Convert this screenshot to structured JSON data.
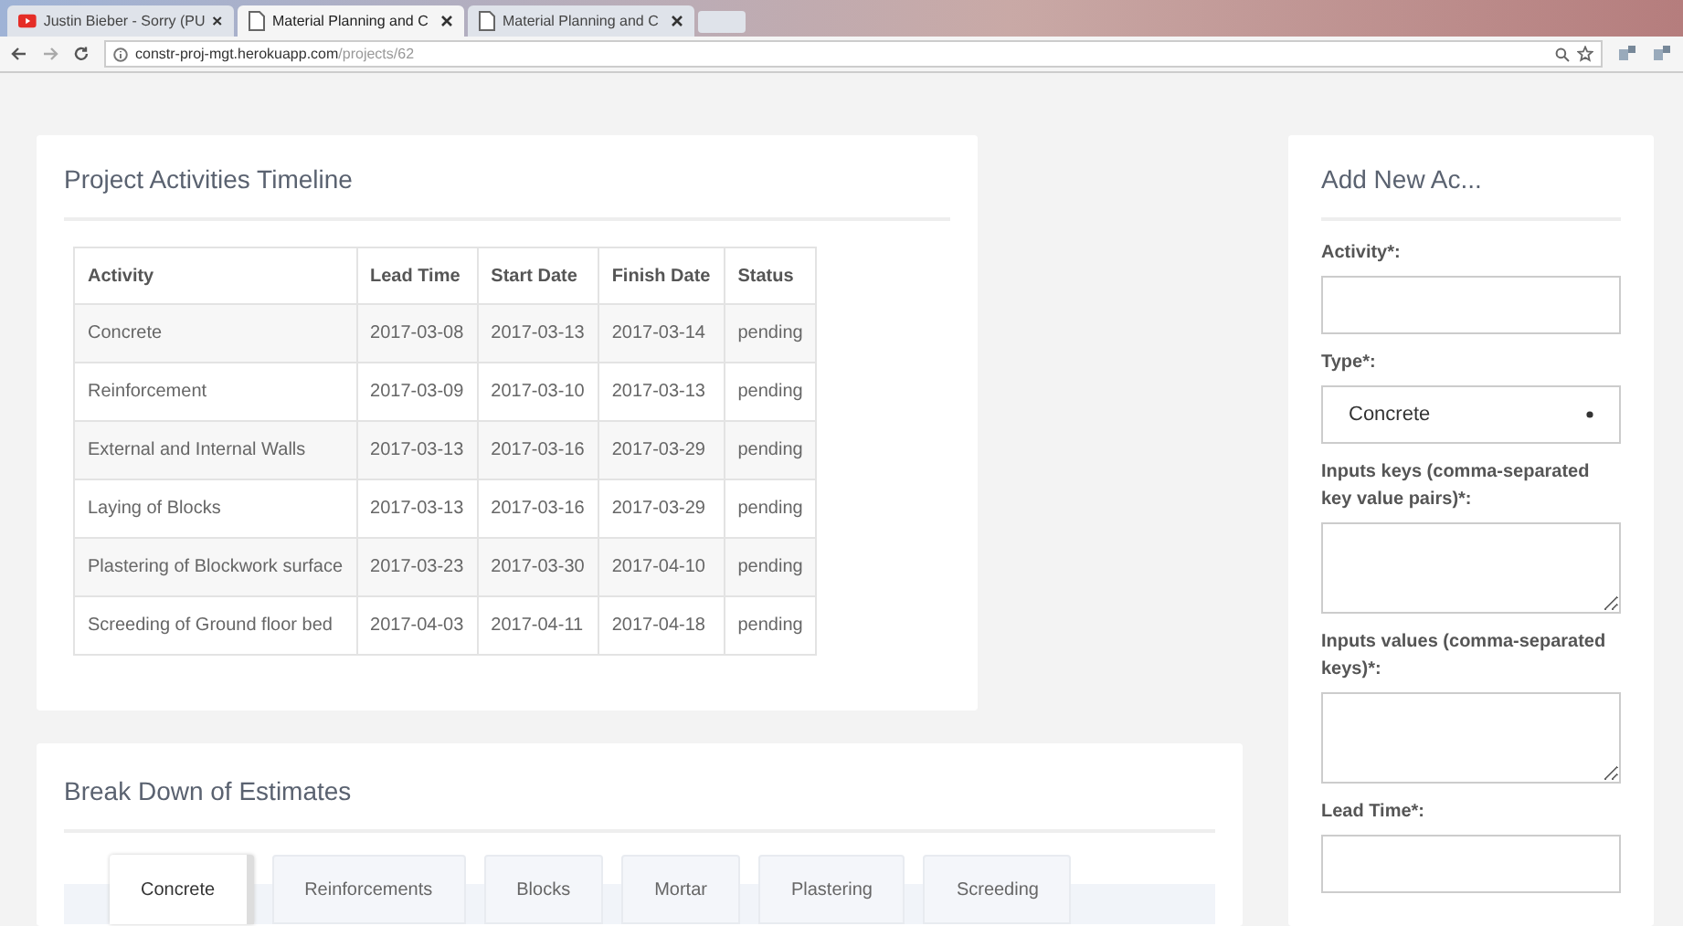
{
  "browser": {
    "tabs": [
      {
        "title": "Justin Bieber - Sorry (PU",
        "kind": "video",
        "selected": false
      },
      {
        "title": "Material Planning and C",
        "kind": "page",
        "selected": true
      },
      {
        "title": "Material Planning and C",
        "kind": "page",
        "selected": false
      }
    ],
    "url": {
      "host": "constr-proj-mgt.herokuapp.com",
      "path": "/projects/62"
    }
  },
  "timeline": {
    "title": "Project Activities Timeline",
    "columns": [
      "Activity",
      "Lead Time",
      "Start Date",
      "Finish Date",
      "Status"
    ],
    "rows": [
      [
        "Concrete",
        "2017-03-08",
        "2017-03-13",
        "2017-03-14",
        "pending"
      ],
      [
        "Reinforcement",
        "2017-03-09",
        "2017-03-10",
        "2017-03-13",
        "pending"
      ],
      [
        "External and Internal Walls",
        "2017-03-13",
        "2017-03-16",
        "2017-03-29",
        "pending"
      ],
      [
        "Laying of Blocks",
        "2017-03-13",
        "2017-03-16",
        "2017-03-29",
        "pending"
      ],
      [
        "Plastering of Blockwork surface",
        "2017-03-23",
        "2017-03-30",
        "2017-04-10",
        "pending"
      ],
      [
        "Screeding of Ground floor bed",
        "2017-04-03",
        "2017-04-11",
        "2017-04-18",
        "pending"
      ]
    ]
  },
  "estimates": {
    "title": "Break Down of Estimates",
    "tabs": [
      {
        "label": "Concrete",
        "selected": true
      },
      {
        "label": "Reinforcements",
        "selected": false
      },
      {
        "label": "Blocks",
        "selected": false
      },
      {
        "label": "Mortar",
        "selected": false
      },
      {
        "label": "Plastering",
        "selected": false
      },
      {
        "label": "Screeding",
        "selected": false
      }
    ]
  },
  "form": {
    "title": "Add New Ac...",
    "fields": [
      {
        "label": "Activity*:",
        "kind": "input"
      },
      {
        "label": "Type*:",
        "kind": "select",
        "value": "Concrete"
      },
      {
        "label": "Inputs keys (comma-separated key value pairs)*:",
        "kind": "textarea"
      },
      {
        "label": "Inputs values (comma-separated keys)*:",
        "kind": "textarea"
      },
      {
        "label": "Lead Time*:",
        "kind": "input"
      }
    ]
  }
}
